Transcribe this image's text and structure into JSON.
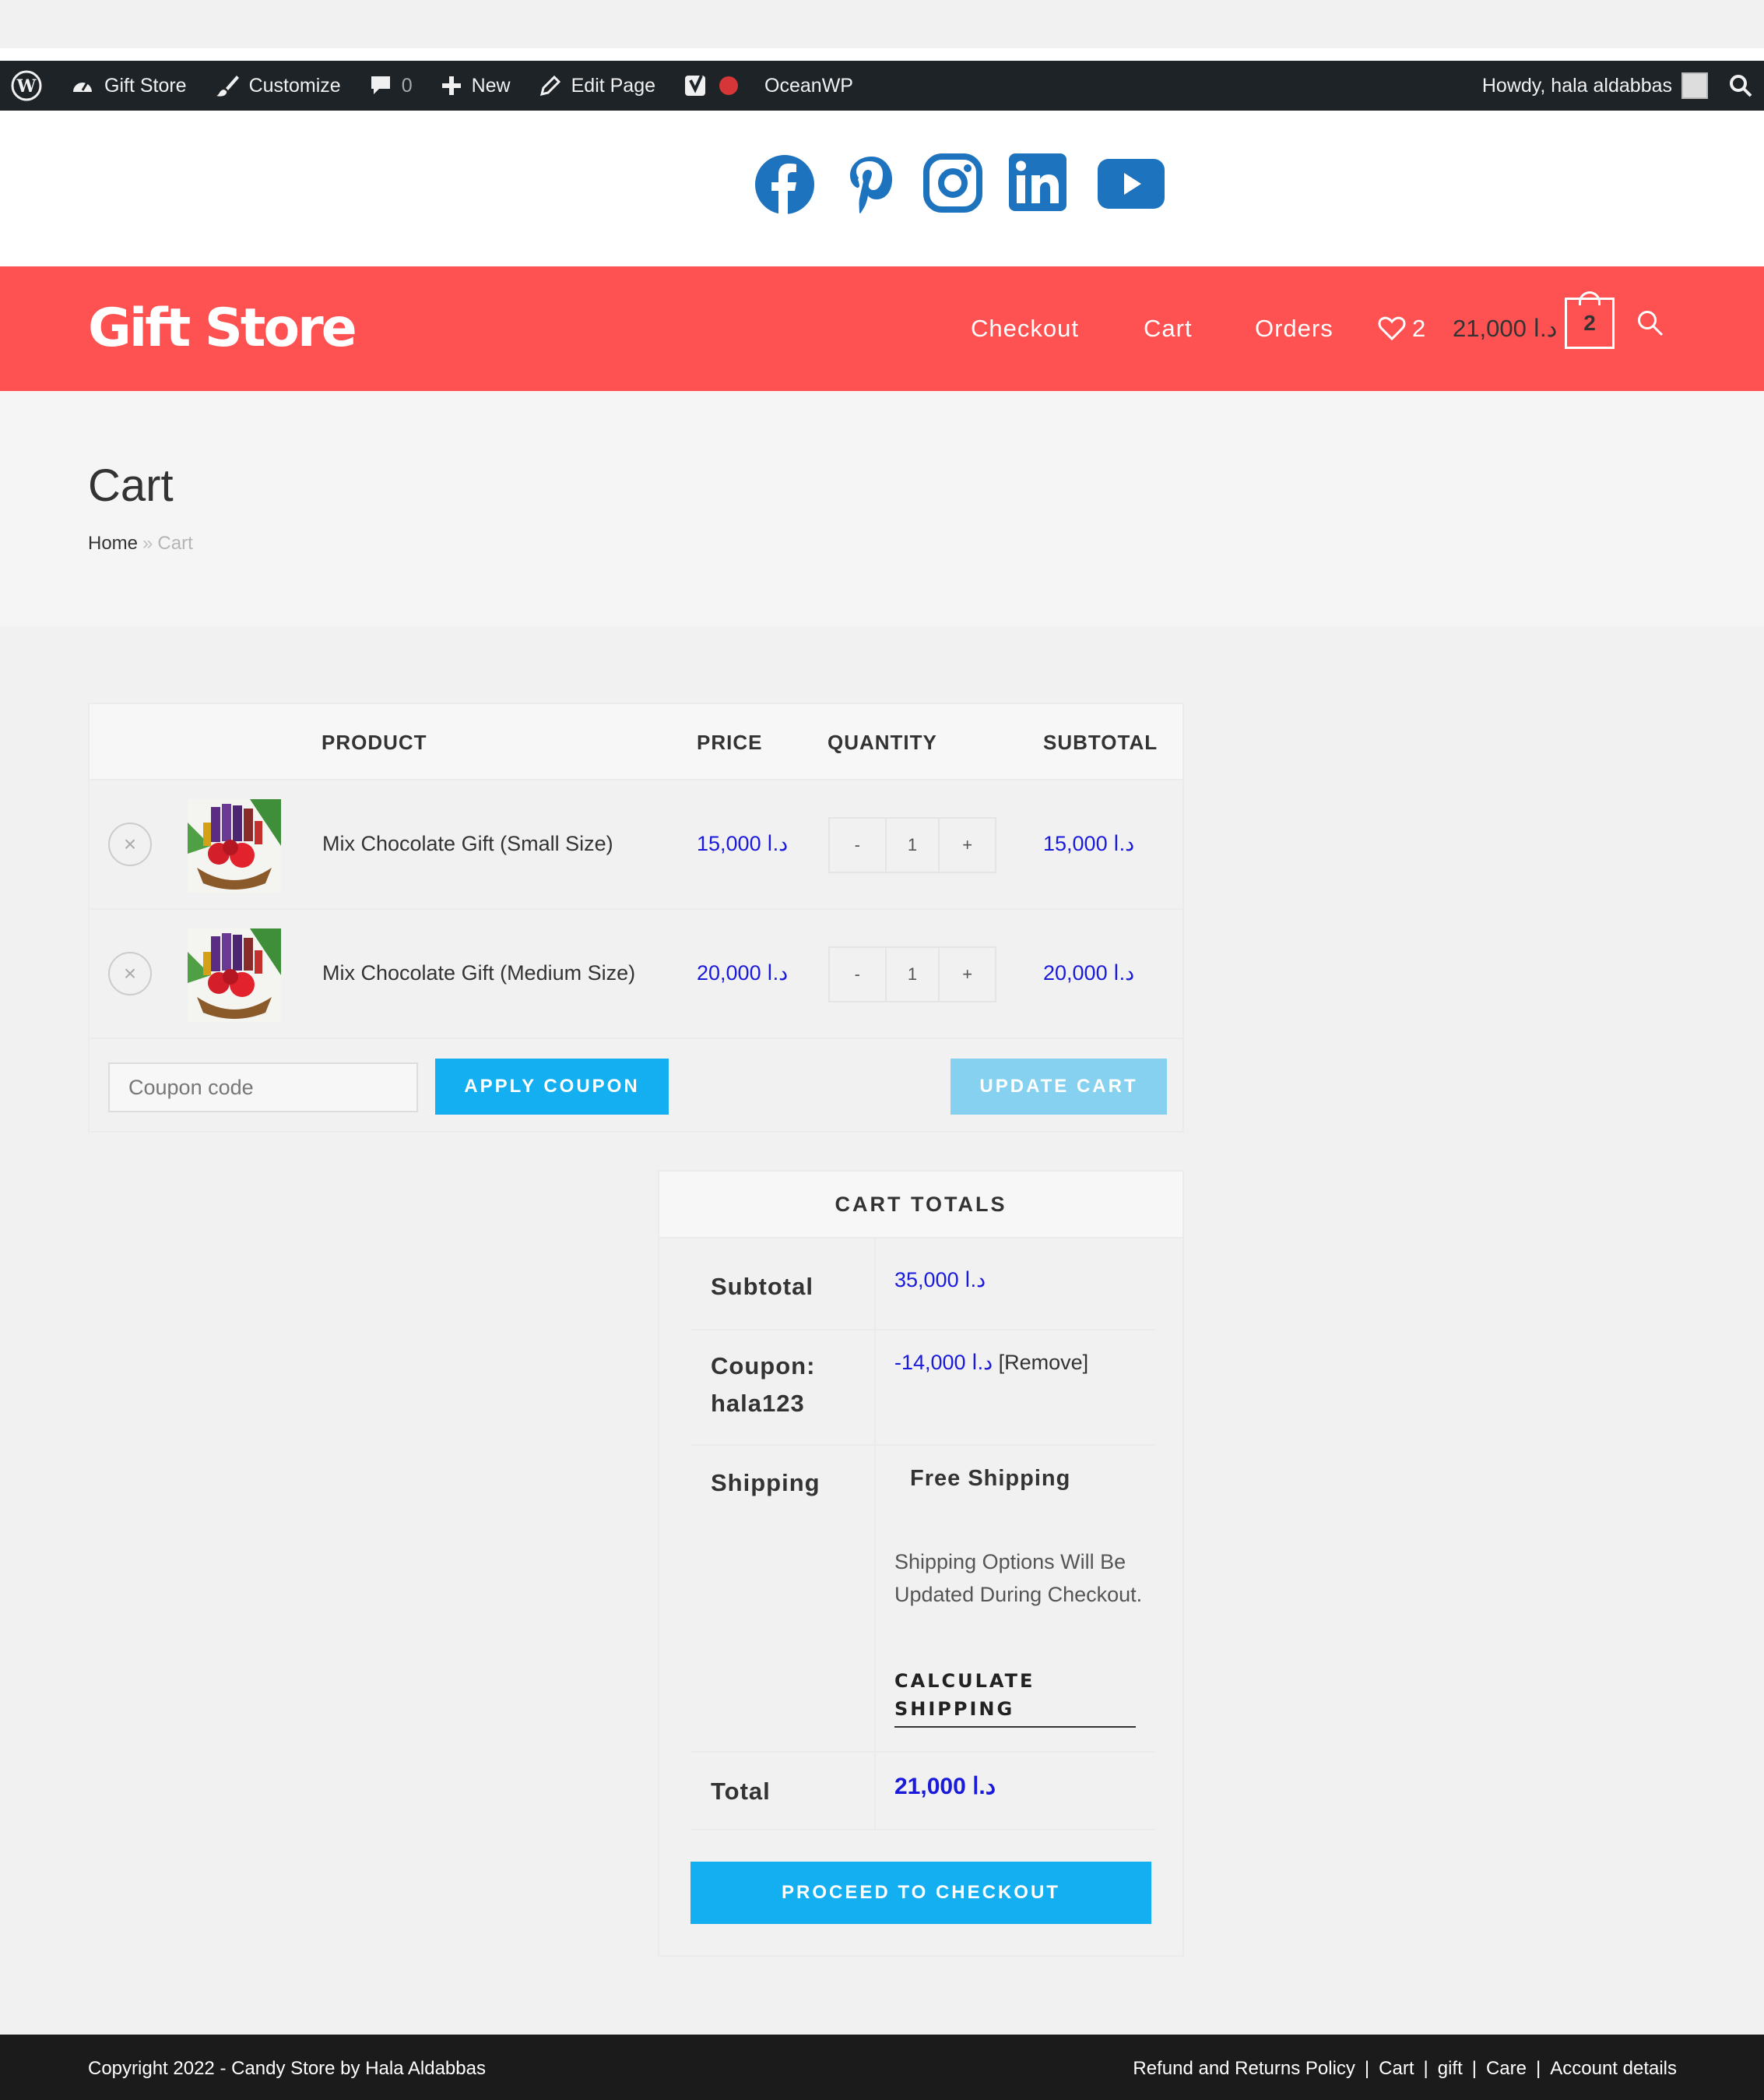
{
  "admin_bar": {
    "site_name": "Gift Store",
    "customize": "Customize",
    "comments_count": "0",
    "new": "New",
    "edit_page": "Edit Page",
    "theme": "OceanWP",
    "howdy": "Howdy, hala aldabbas"
  },
  "social_icons": [
    "facebook-icon",
    "pinterest-icon",
    "instagram-icon",
    "linkedin-icon",
    "youtube-icon"
  ],
  "header": {
    "logo": "Gift Store",
    "menu": {
      "checkout": "Checkout",
      "cart": "Cart",
      "orders": "Orders"
    },
    "wishlist_count": "2",
    "cart_total": "د.ا 21,000",
    "cart_count": "2"
  },
  "page": {
    "title": "Cart",
    "breadcrumb_home": "Home",
    "breadcrumb_sep": "»",
    "breadcrumb_current": "Cart"
  },
  "cart_table": {
    "headers": {
      "product": "PRODUCT",
      "price": "PRICE",
      "quantity": "QUANTITY",
      "subtotal": "SUBTOTAL"
    },
    "items": [
      {
        "name": "Mix Chocolate Gift (Small Size)",
        "price": "د.ا 15,000",
        "qty": "1",
        "subtotal": "د.ا 15,000"
      },
      {
        "name": "Mix Chocolate Gift (Medium Size)",
        "price": "د.ا 20,000",
        "qty": "1",
        "subtotal": "د.ا 20,000"
      }
    ],
    "remove_glyph": "×",
    "qty_minus": "-",
    "qty_plus": "+",
    "coupon_placeholder": "Coupon code",
    "apply_coupon": "APPLY COUPON",
    "update_cart": "UPDATE CART"
  },
  "totals": {
    "title": "CART TOTALS",
    "subtotal_label": "Subtotal",
    "subtotal_value": "د.ا 35,000",
    "coupon_label": "Coupon: hala123",
    "coupon_value": "-14,000 د.ا",
    "coupon_remove": "[Remove]",
    "shipping_label": "Shipping",
    "shipping_method": "Free Shipping",
    "shipping_note": "Shipping Options Will Be Updated During Checkout.",
    "calculate_shipping": "CALCULATE SHIPPING",
    "total_label": "Total",
    "total_value": "د.ا 21,000",
    "checkout_button": "PROCEED TO CHECKOUT"
  },
  "footer": {
    "copyright": "Copyright 2022 - Candy Store by Hala Aldabbas",
    "links": [
      "Refund and Returns Policy",
      "Cart",
      "gift",
      "Care",
      "Account details"
    ],
    "sep": "|"
  },
  "colors": {
    "accent": "#fe5252",
    "button_blue": "#13aff0",
    "button_disabled": "#86d1f0",
    "price_blue": "#1a1adb",
    "social_blue": "#1e73be",
    "admin_bar": "#1d2327"
  }
}
